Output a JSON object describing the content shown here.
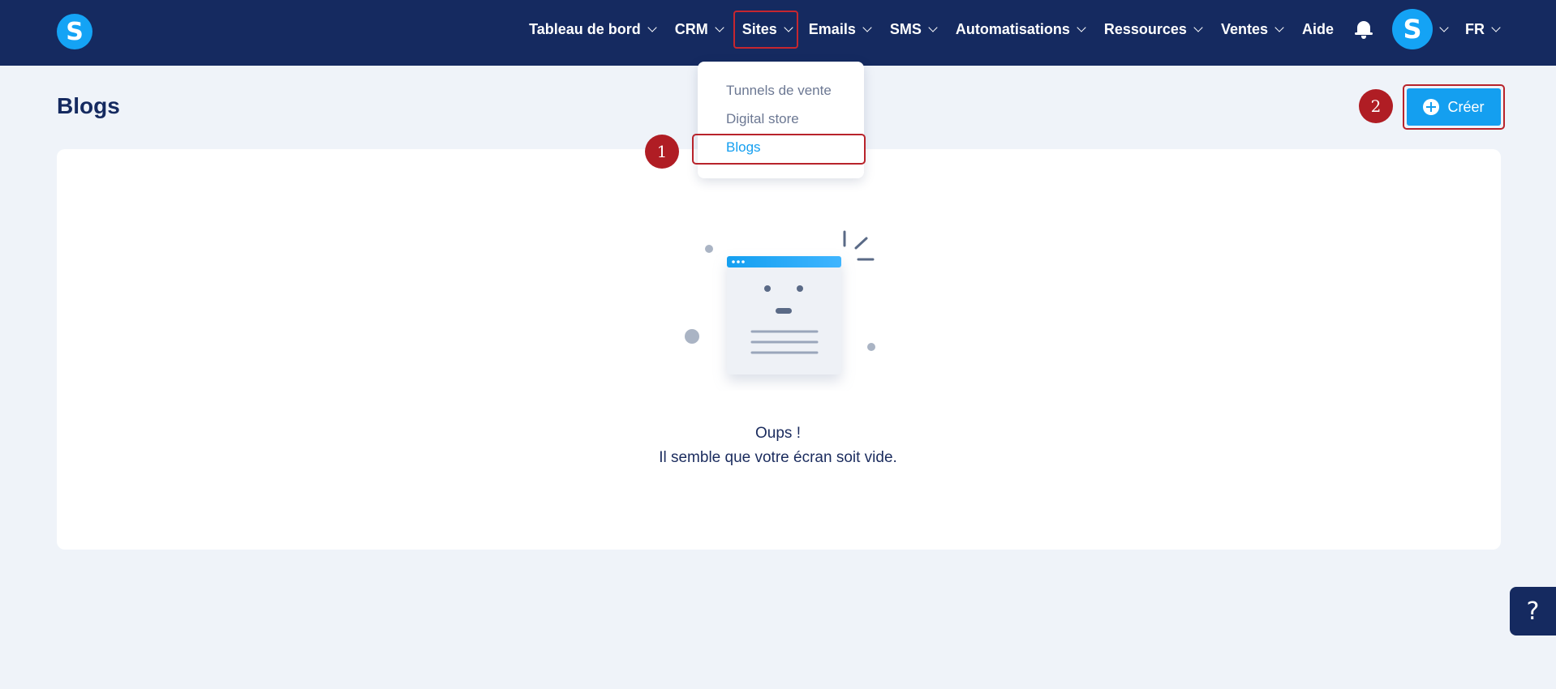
{
  "nav": {
    "logo_letter": "S",
    "items": [
      {
        "label": "Tableau de bord",
        "has_menu": true
      },
      {
        "label": "CRM",
        "has_menu": true
      },
      {
        "label": "Sites",
        "has_menu": true
      },
      {
        "label": "Emails",
        "has_menu": true
      },
      {
        "label": "SMS",
        "has_menu": true
      },
      {
        "label": "Automatisations",
        "has_menu": true
      },
      {
        "label": "Ressources",
        "has_menu": true
      },
      {
        "label": "Ventes",
        "has_menu": true
      },
      {
        "label": "Aide",
        "has_menu": false
      }
    ],
    "avatar_letter": "S",
    "language": "FR"
  },
  "sites_menu": {
    "items": [
      "Tunnels de vente",
      "Digital store",
      "Blogs"
    ],
    "active": "Blogs"
  },
  "page": {
    "title": "Blogs",
    "create_label": "Créer"
  },
  "empty_state": {
    "title": "Oups !",
    "message": "Il semble que votre écran soit vide."
  },
  "annotations": {
    "step1": "1",
    "step2": "2"
  },
  "help": {
    "label": "?"
  },
  "colors": {
    "navbar": "#152a60",
    "accent": "#149ff0",
    "annotation": "#b01d24",
    "background": "#eff3f9"
  }
}
